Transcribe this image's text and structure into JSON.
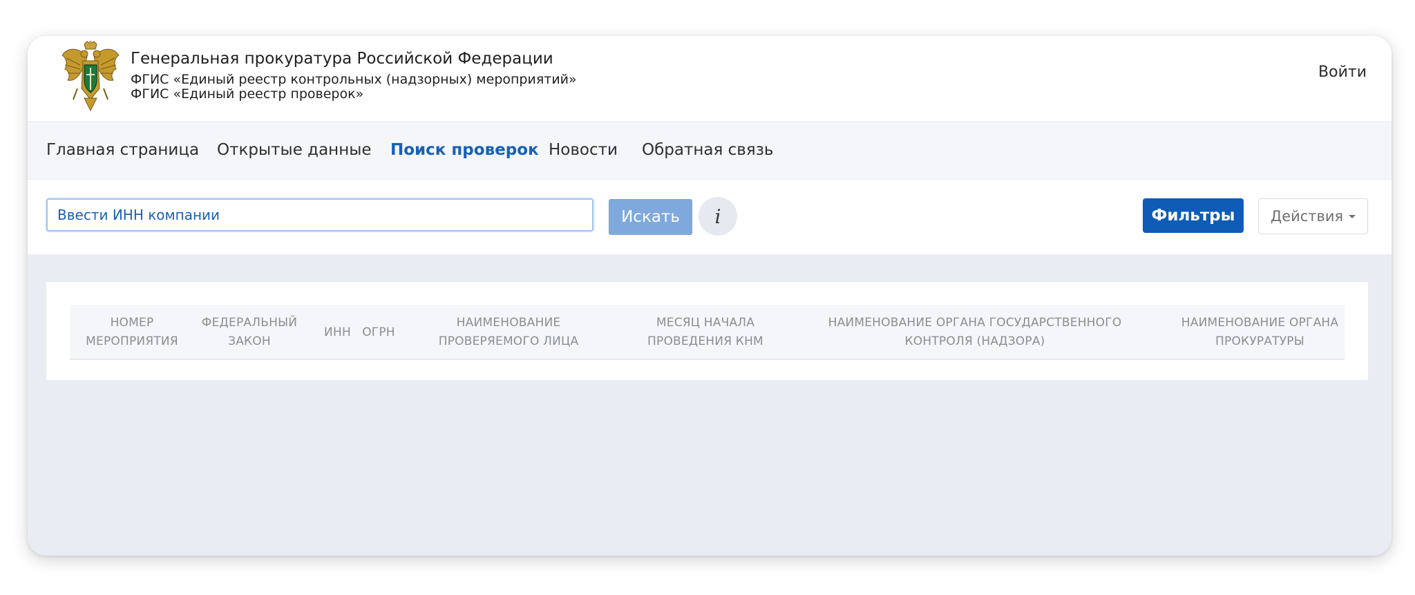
{
  "header": {
    "org_title": "Генеральная прокуратура Российской Федерации",
    "org_sub1": "ФГИС «Единый реестр контрольных (надзорных) мероприятий»",
    "org_sub2": "ФГИС «Единый реестр проверок»",
    "login": "Войти"
  },
  "nav": {
    "items": [
      {
        "label": "Главная страница"
      },
      {
        "label": "Открытые данные"
      },
      {
        "label": "Поиск проверок"
      },
      {
        "label": "Новости"
      },
      {
        "label": "Обратная связь"
      }
    ],
    "active": "Поиск проверок"
  },
  "toolbar": {
    "search_placeholder": "Ввести ИНН компании",
    "search_button": "Искать",
    "info_button": "i",
    "filters_button": "Фильтры",
    "actions_button": "Действия"
  },
  "table": {
    "columns": [
      "НОМЕР МЕРОПРИЯТИЯ",
      "ФЕДЕРАЛЬНЫЙ ЗАКОН",
      "ИНН",
      "ОГРН",
      "НАИМЕНОВАНИЕ ПРОВЕРЯЕМОГО ЛИЦА",
      "МЕСЯЦ НАЧАЛА ПРОВЕДЕНИЯ КНМ",
      "НАИМЕНОВАНИЕ ОРГАНА ГОСУДАРСТВЕННОГО КОНТРОЛЯ (НАДЗОРА)",
      "НАИМЕНОВАНИЕ ОРГАНА ПРОКУРАТУРЫ"
    ],
    "rows": []
  },
  "colors": {
    "accent": "#1760b7",
    "filters_button": "#0e5cb6",
    "search_button": "#7fa8dd",
    "content_background": "#e9ecf3"
  }
}
